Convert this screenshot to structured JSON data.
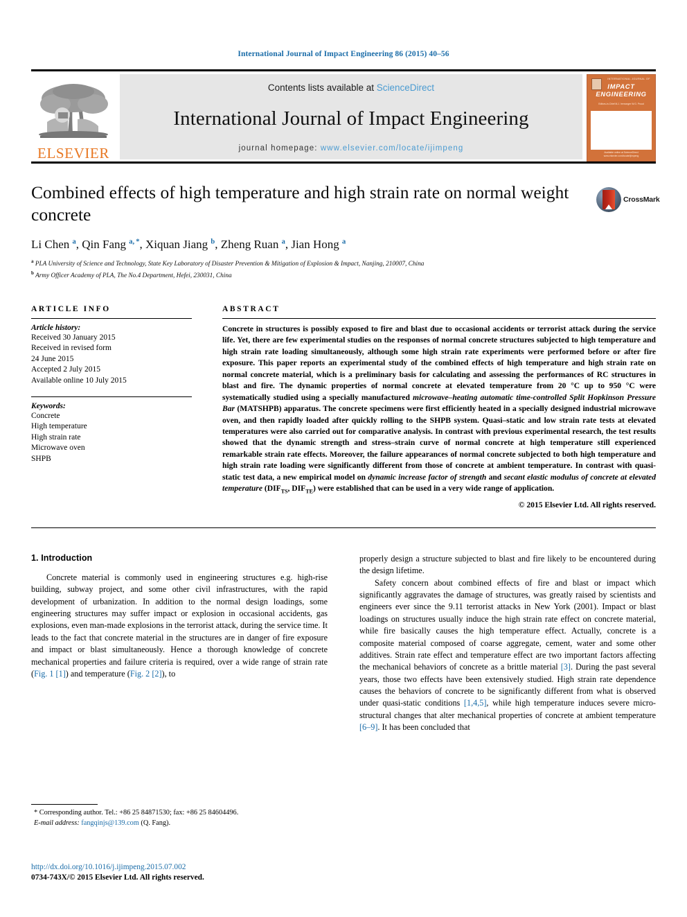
{
  "running_head": "International Journal of Impact Engineering 86 (2015) 40–56",
  "masthead": {
    "contents_prefix": "Contents lists available at",
    "sciencedirect": "ScienceDirect",
    "journal_title": "International Journal of Impact Engineering",
    "homepage_prefix": "journal homepage:",
    "homepage_url": "www.elsevier.com/locate/ijimpeng",
    "publisher": "ELSEVIER",
    "cover": {
      "badge_tiny": "INTERNATIONAL JOURNAL OF",
      "title": "IMPACT ENGINEERING",
      "subtitle": "Editors-in-Chief\nM.J. Iremonger   W.G. Proud",
      "footer": "Available online at\nScienceDirect\nwww.elsevier.com/locate/ijimpeng"
    },
    "accent_link": "#4a9bd1",
    "brand_orange": "#e87722"
  },
  "article": {
    "title": "Combined effects of high temperature and high strain rate on normal weight concrete",
    "crossmark_label": "CrossMark",
    "authors_html": "Li Chen <sup>a</sup>, Qin Fang <sup>a, *</sup>, Xiquan Jiang <sup>b</sup>, Zheng Ruan <sup>a</sup>, Jian Hong <sup>a</sup>",
    "affiliations": [
      "PLA University of Science and Technology, State Key Laboratory of Disaster Prevention & Mitigation of Explosion & Impact, Nanjing, 210007, China",
      "Army Officer Academy of PLA, The No.4 Department, Hefei, 230031, China"
    ],
    "affiliation_marks": [
      "a",
      "b"
    ]
  },
  "article_info": {
    "heading": "ARTICLE INFO",
    "history_label": "Article history:",
    "history": [
      "Received 30 January 2015",
      "Received in revised form",
      "24 June 2015",
      "Accepted 2 July 2015",
      "Available online 10 July 2015"
    ],
    "keywords_label": "Keywords:",
    "keywords": [
      "Concrete",
      "High temperature",
      "High strain rate",
      "Microwave oven",
      "SHPB"
    ]
  },
  "abstract": {
    "heading": "ABSTRACT",
    "body_html": "Concrete in structures is possibly exposed to fire and blast due to occasional accidents or terrorist attack during the service life. Yet, there are few experimental studies on the responses of normal concrete structures subjected to high temperature and high strain rate loading simultaneously, although some high strain rate experiments were performed before or after fire exposure. This paper reports an experimental study of the combined effects of high temperature and high strain rate on normal concrete material, which is a preliminary basis for calculating and assessing the performances of RC structures in blast and fire. The dynamic properties of normal concrete at elevated temperature from 20 °C up to 950 °C were systematically studied using a specially manufactured <i>microwave–heating automatic time-controlled Split Hopkinson Pressure Bar</i> (MATSHPB) apparatus. The concrete specimens were first efficiently heated in a specially designed industrial microwave oven, and then rapidly loaded after quickly rolling to the SHPB system. Quasi–static and low strain rate tests at elevated temperatures were also carried out for comparative analysis. In contrast with previous experimental research, the test results showed that the dynamic strength and stress–strain curve of normal concrete at high temperature still experienced remarkable strain rate effects. Moreover, the failure appearances of normal concrete subjected to both high temperature and high strain rate loading were significantly different from those of concrete at ambient temperature. In contrast with quasi-static test data, a new empirical model on <i>dynamic increase factor of strength</i> and <i>secant elastic modulus of concrete at elevated temperature</i> (DIF<sub>TS</sub>, DIF<sub>TE</sub>) were established that can be used in a very wide range of application.",
    "copyright": "© 2015 Elsevier Ltd. All rights reserved."
  },
  "body": {
    "section_heading": "1. Introduction",
    "left_paragraphs_html": [
      "Concrete material is commonly used in engineering structures e.g. high-rise building, subway project, and some other civil infrastructures, with the rapid development of urbanization. In addition to the normal design loadings, some engineering structures may suffer impact or explosion in occasional accidents, gas explosions, even man-made explosions in the terrorist attack, during the service time. It leads to the fact that concrete material in the structures are in danger of fire exposure and impact or blast simultaneously. Hence a thorough knowledge of concrete mechanical properties and failure criteria is required, over a wide range of strain rate (<span class=\"ref\">Fig. 1 [1]</span>) and temperature (<span class=\"ref\">Fig. 2 [2]</span>), to"
    ],
    "right_paragraphs_html": [
      "properly design a structure subjected to blast and fire likely to be encountered during the design lifetime.",
      "Safety concern about combined effects of fire and blast or impact which significantly aggravates the damage of structures, was greatly raised by scientists and engineers ever since the 9.11 terrorist attacks in New York (2001). Impact or blast loadings on structures usually induce the high strain rate effect on concrete material, while fire basically causes the high temperature effect. Actually, concrete is a composite material composed of coarse aggregate, cement, water and some other additives. Strain rate effect and temperature effect are two important factors affecting the mechanical behaviors of concrete as a brittle material <span class=\"ref\">[3]</span>. During the past several years, those two effects have been extensively studied. High strain rate dependence causes the behaviors of concrete to be significantly different from what is observed under quasi-static conditions <span class=\"ref\">[1,4,5]</span>, while high temperature induces severe micro-structural changes that alter mechanical properties of concrete at ambient temperature <span class=\"ref\">[6–9]</span>. It has been concluded that"
    ]
  },
  "footnotes": {
    "corresponding_html": "* Corresponding author. Tel.: +86 25 84871530; fax: +86 25 84604496.",
    "email_html": "<span class=\"em\">E-mail address:</span> <span class=\"mail\">fangqinjs@139.com</span> (Q. Fang).",
    "doi": "http://dx.doi.org/10.1016/j.ijimpeng.2015.07.002",
    "issn": "0734-743X/© 2015 Elsevier Ltd. All rights reserved."
  }
}
